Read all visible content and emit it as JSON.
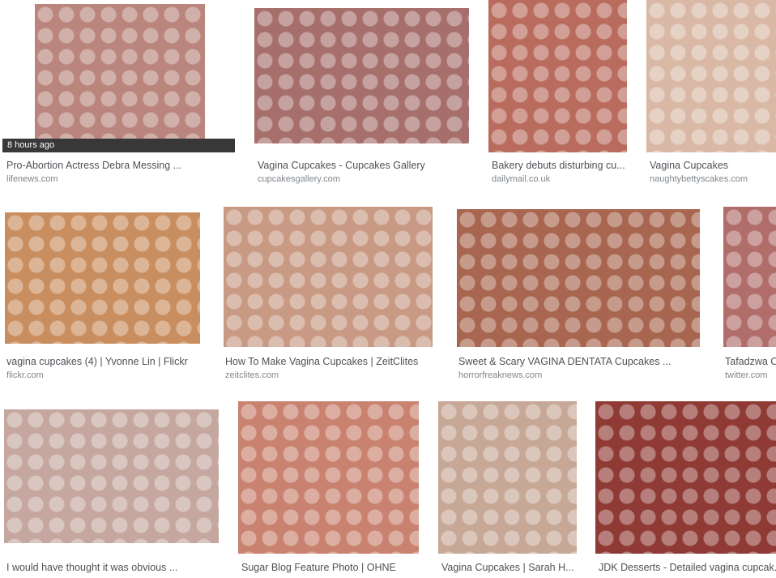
{
  "results": [
    {
      "title": "Pro-Abortion Actress Debra Messing ...",
      "source": "lifenews.com",
      "badge": "8 hours ago",
      "color": "#b9857d"
    },
    {
      "title": "Vagina Cupcakes - Cupcakes Gallery",
      "source": "cupcakesgallery.com",
      "color": "#a66f6b"
    },
    {
      "title": "Bakery debuts disturbing cu...",
      "source": "dailymail.co.uk",
      "color": "#b96c5d"
    },
    {
      "title": "Vagina Cupcakes",
      "source": "naughtybettyscakes.com",
      "color": "#d9b9a6"
    },
    {
      "title": "vagina cupcakes (4) | Yvonne Lin | Flickr",
      "source": "flickr.com",
      "color": "#c98e5f"
    },
    {
      "title": "How To Make Vagina Cupcakes | ZeitClites",
      "source": "zeitclites.com",
      "color": "#c89a84"
    },
    {
      "title": "Sweet & Scary VAGINA DENTATA Cupcakes ...",
      "source": "horrorfreaknews.com",
      "color": "#a8654f"
    },
    {
      "title": "Tafadzwa C",
      "source": "twitter.com",
      "color": "#b06d6a"
    },
    {
      "title": "I would have thought it was obvious ...",
      "source": "",
      "color": "#c5a7a0"
    },
    {
      "title": "Sugar Blog Feature Photo | OHNE",
      "source": "",
      "color": "#c98270"
    },
    {
      "title": "Vagina Cupcakes | Sarah H...",
      "source": "",
      "color": "#c7a796"
    },
    {
      "title": "JDK Desserts - Detailed vagina cupcak...",
      "source": "",
      "color": "#8f3a34"
    }
  ]
}
